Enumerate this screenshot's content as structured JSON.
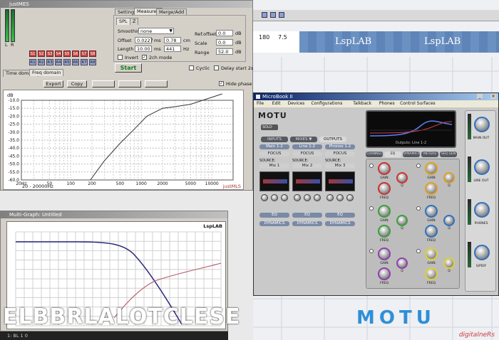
{
  "meas_window": {
    "title": "justMES",
    "settings_tabs": [
      "Settings",
      "Measure1",
      "Merge/Add"
    ],
    "spl_tabs": [
      "SPL",
      "Z"
    ],
    "smoothing_label": "Smoothing",
    "smoothing_value": "none",
    "offset_label": "Offset",
    "offset_value": "0.0227",
    "offset_unit": "ms",
    "offset_cm_value": "0.78",
    "offset_cm_unit": "cm",
    "length_label": "Length",
    "length_value": "10.00",
    "length_unit": "ms",
    "length_hz_value": "441",
    "length_hz_unit": "Hz",
    "ref_offset_label": "Ref.offset",
    "ref_offset_value": "0.0",
    "ref_offset_unit": "dB",
    "scale_label": "Scale",
    "scale_value": "0.0",
    "scale_unit": "dB",
    "range_label": "Range",
    "range_value": "52.0",
    "range_unit": "dB",
    "invert_label": "Invert",
    "twoch_label": "2ch mode",
    "start_label": "Start",
    "cyclic_label": "Cyclic",
    "delay_label": "Delay start 2s",
    "domain_tabs": [
      "Time domain",
      "Freq domain"
    ],
    "export_label": "Export",
    "copy_label": "Copy",
    "hide_phase_label": "Hide phase",
    "meter_labels": [
      "L",
      "R"
    ],
    "s_buttons": [
      "S1",
      "S2",
      "S3",
      "S4",
      "S5",
      "S6",
      "S7",
      "S8"
    ],
    "r_buttons": [
      "R1",
      "R2",
      "R3",
      "R4",
      "R5",
      "R6",
      "R7",
      "R8"
    ],
    "plot_unit": "dB",
    "x_ticks": [
      "20Hz",
      "50",
      "100",
      "200",
      "500",
      "1000",
      "2000",
      "5000",
      "10000"
    ],
    "range_text": "20 - 20000Hz",
    "y_ticks": [
      "-10.0",
      "-15.0",
      "-20.0",
      "-25.0",
      "-30.0",
      "-35.0",
      "-40.0",
      "-45.0",
      "-50.0",
      "-55.0",
      "-60.0"
    ],
    "watermark": "justMLS"
  },
  "multigraph": {
    "title": "Multi-Graph: Untitled",
    "brand": "LspLAB",
    "footer_text": "1: BL 1 0"
  },
  "top_strip": {
    "brand": "LspLAB",
    "ruler_a": "180",
    "ruler_b": "7.5"
  },
  "motu": {
    "title": "MicroBook II",
    "menu": [
      "File",
      "Edit",
      "Devices",
      "Configurations",
      "Talkback",
      "Phones",
      "Control Surfaces"
    ],
    "brand": "MOTU",
    "solo_label": "SOLO",
    "mix_tabs": [
      "INPUTS",
      "MIXES ▼",
      "OUTPUTS"
    ],
    "outputs": [
      {
        "name": "Main 1-2",
        "focus": "FOCUS",
        "source_label": "SOURCE:",
        "source": "Mix 1",
        "eq": "EQ",
        "dyn": "DYNAMICS"
      },
      {
        "name": "Line 1-2",
        "focus": "FOCUS",
        "source_label": "SOURCE:",
        "source": "Mix 2",
        "eq": "EQ",
        "dyn": "DYNAMICS"
      },
      {
        "name": "Phones 1-2",
        "focus": "FOCUS",
        "source_label": "SOURCE:",
        "source": "Mix 3",
        "eq": "EQ",
        "dyn": "DYNAMICS"
      }
    ],
    "eq_caption": "Outputs: Line 1-2",
    "ch_tabs": [
      "CHANNEL",
      "EQ",
      "DYNAMICS",
      "METERS",
      "SEQ GEN"
    ],
    "eq_knob_labels": [
      "GAIN",
      "FREQ",
      "Q"
    ],
    "eq_bands": [
      {
        "gain_label": "GAIN",
        "freq_label": "FREQ",
        "q_label": "Q",
        "ring": "#cc3333"
      },
      {
        "gain_label": "GAIN",
        "freq_label": "FREQ",
        "q_label": "Q",
        "ring": "#e0a020"
      },
      {
        "gain_label": "GAIN",
        "freq_label": "FREQ",
        "q_label": "Q",
        "ring": "#3aa03a"
      },
      {
        "gain_label": "GAIN",
        "freq_label": "FREQ",
        "q_label": "Q",
        "ring": "#3070c0"
      },
      {
        "gain_label": "GAIN",
        "freq_label": "FREQ",
        "q_label": "Q",
        "ring": "#9040b0"
      },
      {
        "gain_label": "GAIN",
        "freq_label": "FREQ",
        "q_label": "Q",
        "ring": "#e0d030"
      }
    ],
    "side_labels": [
      "MAIN OUT",
      "LINE OUT",
      "PHONES",
      "S/PDIF"
    ],
    "side_numbers": [
      "12",
      "13",
      "14",
      "15",
      "16",
      "17",
      "18"
    ]
  },
  "overlay": {
    "left_text": "ELBBRLALOTCLESE",
    "right_brand": "MOTU",
    "right_sub": "digitalneRs"
  }
}
